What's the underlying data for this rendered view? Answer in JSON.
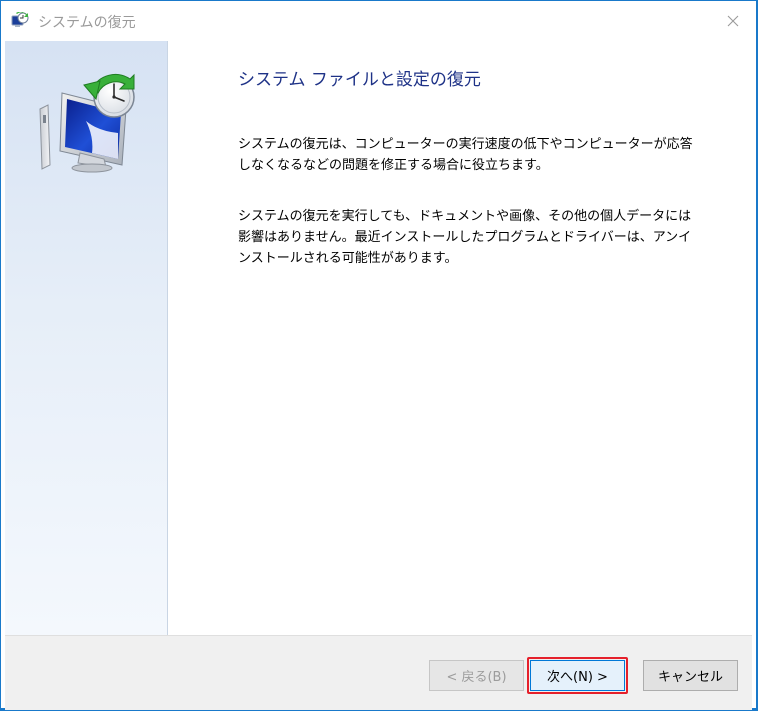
{
  "window": {
    "title": "システムの復元",
    "close_label": "✕"
  },
  "icons": {
    "app": "system-restore-icon",
    "sidebar": "system-restore-monitor-clock-icon",
    "close": "close-icon"
  },
  "content": {
    "heading": "システム ファイルと設定の復元",
    "paragraph1": "システムの復元は、コンピューターの実行速度の低下やコンピューターが応答しなくなるなどの問題を修正する場合に役立ちます。",
    "paragraph2": "システムの復元を実行しても、ドキュメントや画像、その他の個人データには影響はありません。最近インストールしたプログラムとドライバーは、アンインストールされる可能性があります。"
  },
  "buttons": {
    "back": "< 戻る(B)",
    "next": "次へ(N) >",
    "cancel": "キャンセル"
  },
  "colors": {
    "accent": "#1979ca",
    "heading": "#1e3287",
    "highlight": "#e5202b"
  }
}
